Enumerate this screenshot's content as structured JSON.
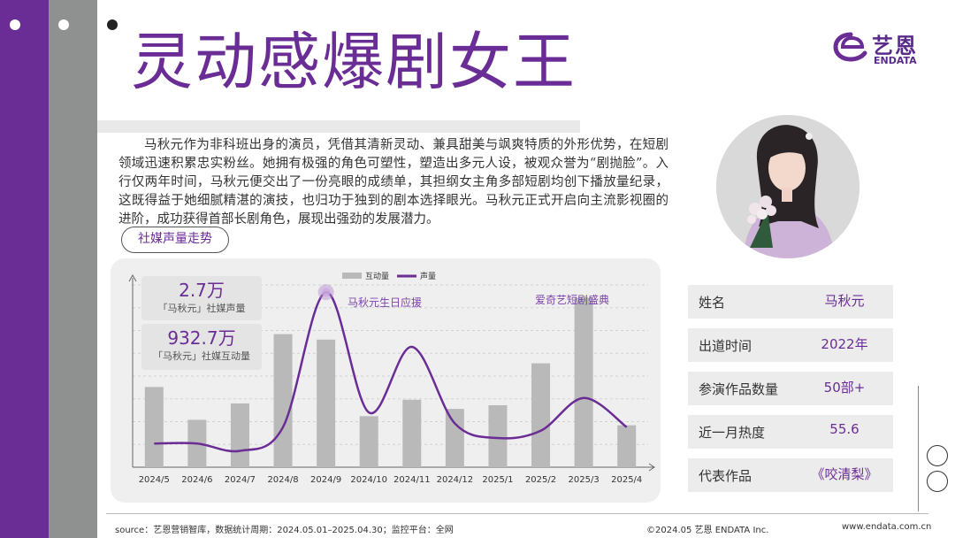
{
  "title": "灵动感爆剧女王",
  "logo": {
    "cn": "艺恩",
    "en": "ENDATA"
  },
  "intro": "马秋元作为非科班出身的演员，凭借其清新灵动、兼具甜美与飒爽特质的外形优势，在短剧领域迅速积累忠实粉丝。她拥有极强的角色可塑性，塑造出多元人设，被观众誉为“剧抛脸”。入行仅两年时间，马秋元便交出了一份亮眼的成绩单，其担纲女主角多部短剧均创下播放量纪录，这既得益于她细腻精湛的演技，也归功于独到的剧本选择眼光。马秋元正式开启向主流影视圈的进阶，成功获得首部长剧角色，展现出强劲的发展潜力。",
  "section_label": "社媒声量走势",
  "stats": [
    {
      "value": "2.7万",
      "label": "「马秋元」社媒声量"
    },
    {
      "value": "932.7万",
      "label": "「马秋元」社媒互动量"
    }
  ],
  "annotations": {
    "birthday": "马秋元生日应援",
    "festival": "爱奇艺短剧盛典"
  },
  "info": [
    {
      "label": "姓名",
      "value": "马秋元"
    },
    {
      "label": "出道时间",
      "value": "2022年"
    },
    {
      "label": "参演作品数量",
      "value": "50部+"
    },
    {
      "label": "近一月热度",
      "value": "55.6"
    },
    {
      "label": "代表作品",
      "value": "《咬清梨》"
    }
  ],
  "footer": {
    "source": "source：艺恩营销智库，数据统计周期：2024.05.01–2025.04.30；监控平台：全网",
    "copyright": "©2024.05  艺恩 ENDATA Inc.",
    "site": "www.endata.com.cn"
  },
  "colors": {
    "purple": "#6a2c95",
    "gray_stripe": "#8f9191",
    "bar": "#b9b9b9",
    "line": "#6a2c95"
  },
  "chart_data": {
    "type": "bar",
    "categories": [
      "2024/5",
      "2024/6",
      "2024/7",
      "2024/8",
      "2024/9",
      "2024/10",
      "2024/11",
      "2024/12",
      "2025/1",
      "2025/2",
      "2025/3",
      "2025/4"
    ],
    "series": [
      {
        "name": "互动量",
        "type": "bar",
        "values": [
          44,
          26,
          35,
          73,
          70,
          28,
          37,
          32,
          34,
          57,
          93,
          23
        ]
      },
      {
        "name": "声量",
        "type": "line",
        "values": [
          13,
          13,
          9,
          22,
          96,
          30,
          66,
          24,
          16,
          20,
          38,
          22
        ]
      }
    ],
    "ylim": [
      0,
      100
    ],
    "grid": true,
    "legend_position": "top-center",
    "peak_marker_index": 4
  }
}
